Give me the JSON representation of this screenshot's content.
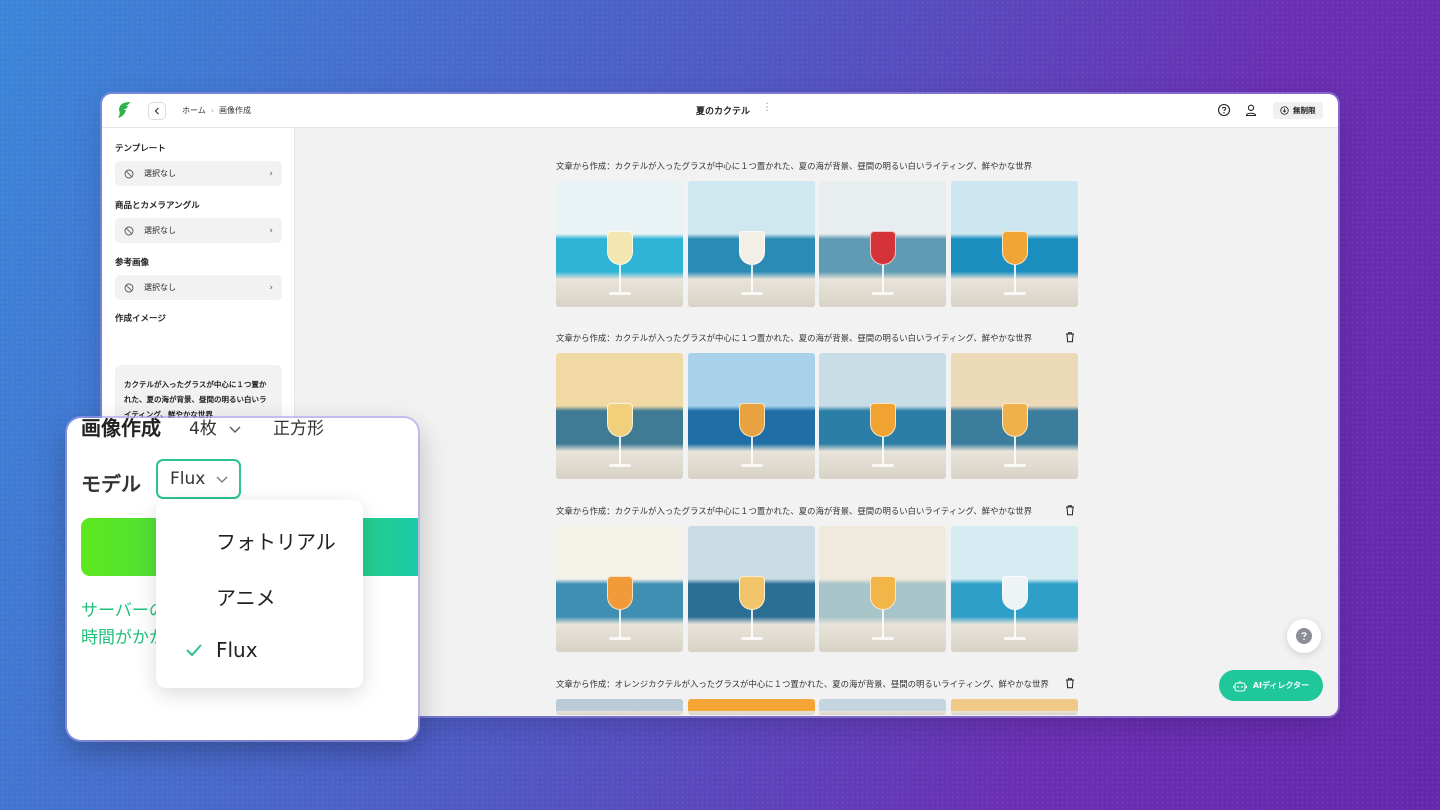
{
  "header": {
    "breadcrumb": [
      "ホーム",
      "画像作成"
    ],
    "title": "夏のカクテル",
    "plan_label": "無制限"
  },
  "sidebar": {
    "template_label": "テンプレート",
    "template_value": "選択なし",
    "product_label": "商品とカメラアングル",
    "product_value": "選択なし",
    "reference_label": "参考画像",
    "reference_value": "選択なし",
    "image_label": "作成イメージ",
    "prompt": "カクテルが入ったグラスが中心に１つ置かれた、夏の海が背景、昼間の明るい白いライティング、鮮やかな世界"
  },
  "groups": [
    {
      "caption": "文章から作成：カクテルが入ったグラスが中心に１つ置かれた、夏の海が背景、昼間の明るい白いライティング、鮮やかな世界",
      "images": [
        {
          "sky": "#e9f2f4",
          "sea": "#2fb4d6",
          "drink": "#f4e6b0"
        },
        {
          "sky": "#cfe7ef",
          "sea": "#2a8bb5",
          "drink": "#f3efe6"
        },
        {
          "sky": "#e8eef0",
          "sea": "#5f9bb3",
          "drink": "#d5333a"
        },
        {
          "sky": "#cde6f0",
          "sea": "#1b8fbf",
          "drink": "#f0a535"
        }
      ]
    },
    {
      "caption": "文章から作成：カクテルが入ったグラスが中心に１つ置かれた、夏の海が背景、昼間の明るい白いライティング、鮮やかな世界",
      "images": [
        {
          "sky": "#f1d9a5",
          "sea": "#3f7b93",
          "drink": "#f2cf7b"
        },
        {
          "sky": "#a8d2ea",
          "sea": "#1f6fa6",
          "drink": "#e9a240"
        },
        {
          "sky": "#c9dde6",
          "sea": "#2b7ea6",
          "drink": "#f0a330"
        },
        {
          "sky": "#ecd9b8",
          "sea": "#3b7d9c",
          "drink": "#eeb14b"
        }
      ]
    },
    {
      "caption": "文章から作成：カクテルが入ったグラスが中心に１つ置かれた、夏の海が背景、昼間の明るい白いライティング、鮮やかな世界",
      "images": [
        {
          "sky": "#f5f2ea",
          "sea": "#3f8fb3",
          "drink": "#f09a3a"
        },
        {
          "sky": "#c9dbe3",
          "sea": "#2c6f94",
          "drink": "#f3c56a"
        },
        {
          "sky": "#f0eadc",
          "sea": "#a7c4c9",
          "drink": "#f2b547"
        },
        {
          "sky": "#d6ecf3",
          "sea": "#2e9fc8",
          "drink": "#eef4f5"
        }
      ]
    },
    {
      "caption": "文章から作成：オレンジカクテルが入ったグラスが中心に１つ置かれた、夏の海が背景、昼間の明るいライティング、鮮やかな世界",
      "images": [
        {
          "sky": "#b9cbd6",
          "sea": "#b9cbd6",
          "drink": "#b9cbd6"
        },
        {
          "sky": "#f4a536",
          "sea": "#f4a536",
          "drink": "#f4a536"
        },
        {
          "sky": "#c3d6e0",
          "sea": "#c3d6e0",
          "drink": "#c3d6e0"
        },
        {
          "sky": "#f0c987",
          "sea": "#f0c987",
          "drink": "#f0c987"
        }
      ]
    }
  ],
  "floating": {
    "ai_director": "AIディレクター"
  },
  "zoom": {
    "section_title": "画像作成",
    "count": "4枚",
    "shape": "正方形",
    "model_label": "モデル",
    "model_value": "Flux",
    "options": [
      "フォトリアル",
      "アニメ",
      "Flux"
    ],
    "selected_option": "Flux",
    "message_line1": "サーバーの状況によって完了までに",
    "message_line2": "時間がかかる場合があります"
  },
  "colors": {
    "accent": "#1fc79a",
    "select_border": "#2cc38f"
  }
}
